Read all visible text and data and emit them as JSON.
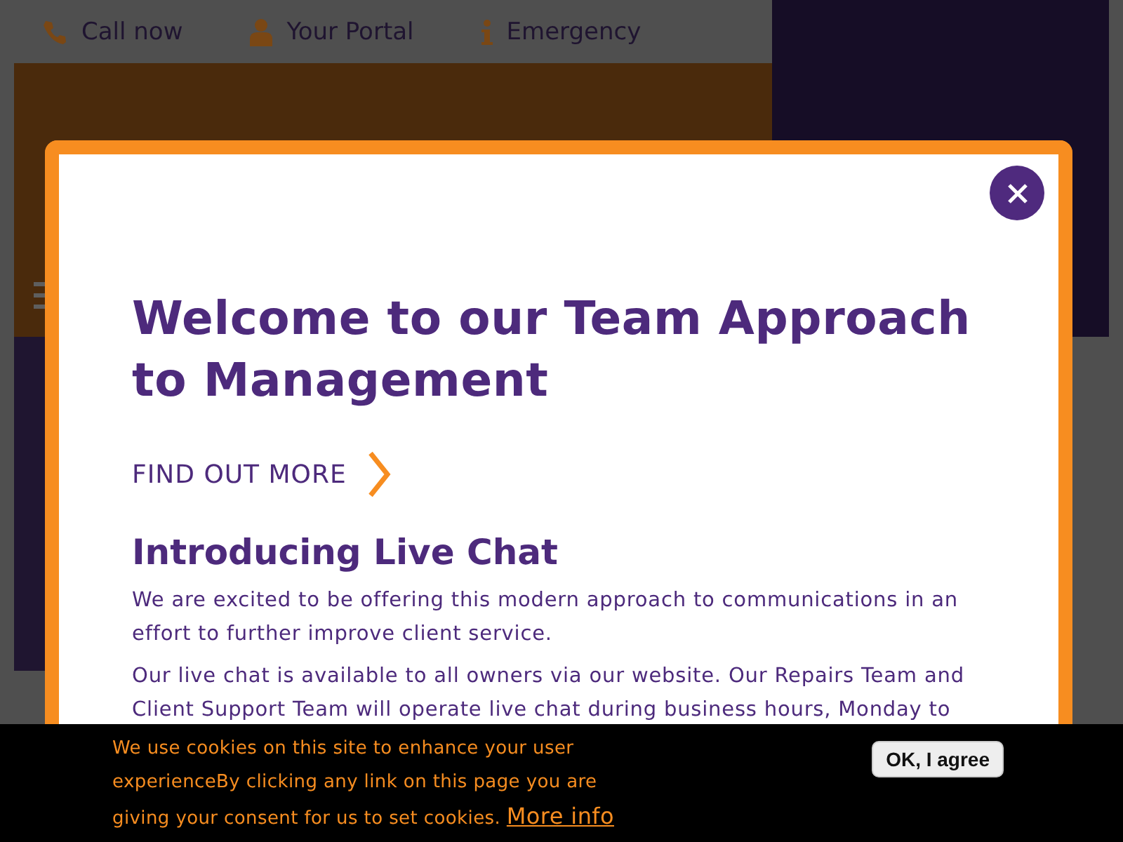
{
  "top_bar": {
    "items": [
      {
        "kind": "phone",
        "label": "Call now"
      },
      {
        "kind": "person",
        "label": "Your Portal"
      },
      {
        "kind": "info",
        "label": "Emergency"
      }
    ]
  },
  "modal": {
    "title": "Welcome to our Team Approach to Management",
    "link": "FIND OUT MORE",
    "heading": "Introducing Live Chat",
    "paragraphs": [
      "We are excited to be offering this modern approach to communications in an effort to further improve client service.",
      "Our live chat is available to all owners via our website. Our Repairs Team and Client Support Team will operate live chat during business hours, Monday to"
    ]
  },
  "cookie_bar": {
    "message": "We use cookies on this site to enhance your user experienceBy clicking any link on this page you are giving your consent for us to set cookies.",
    "link": "More info",
    "button": "OK, I agree"
  }
}
